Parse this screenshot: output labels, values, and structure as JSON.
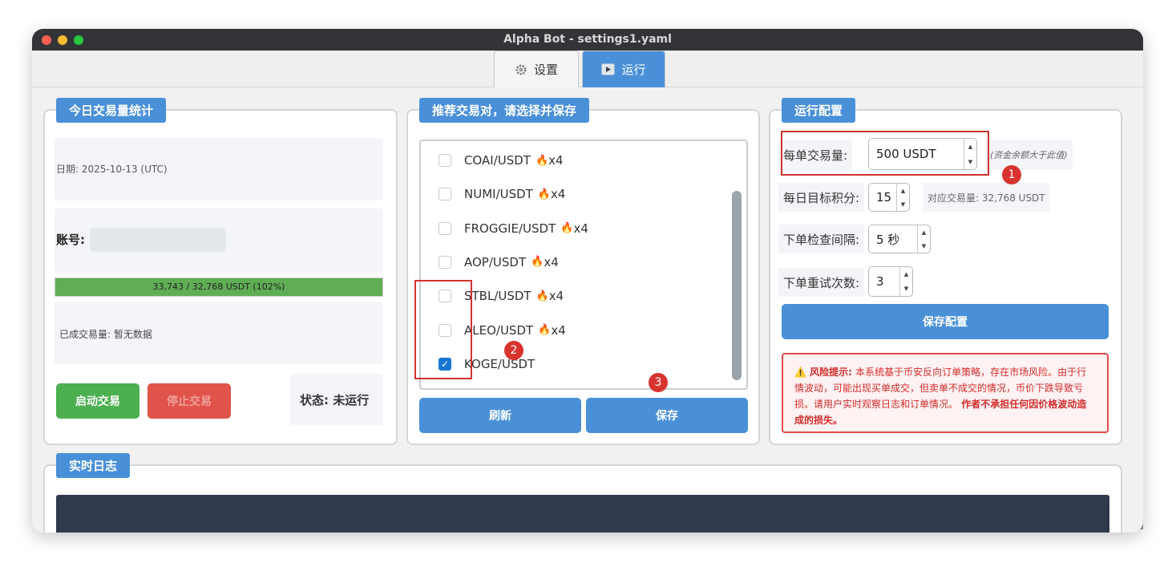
{
  "window": {
    "title": "Alpha Bot - settings1.yaml"
  },
  "colors": {
    "accent": "#4a90d9",
    "start": "#4caf50",
    "stop": "#e0534a",
    "warning": "#d42b2b",
    "progress": "#5fae54"
  },
  "tabs": [
    {
      "label": "设置",
      "icon": "gear-icon"
    },
    {
      "label": "运行",
      "icon": "play-icon"
    }
  ],
  "stats": {
    "title": "今日交易量统计",
    "date": "日期: 2025-10-13 (UTC)",
    "account_label": "账号: ı",
    "progress_text": "33,743 / 32,768 USDT (102%)",
    "progress_value": 1.0,
    "traded_label": "已成交易量: 暂无数据",
    "start_button": "启动交易",
    "stop_button": "停止交易",
    "status": "状态: 未运行"
  },
  "pairs": {
    "title": "推荐交易对，请选择并保存",
    "items": [
      {
        "label": "COAI/USDT",
        "multiplier": "x4",
        "hot": true,
        "checked": false
      },
      {
        "label": "NUMI/USDT",
        "multiplier": "x4",
        "hot": true,
        "checked": false
      },
      {
        "label": "FROGGIE/USDT",
        "multiplier": "x4",
        "hot": true,
        "checked": false
      },
      {
        "label": "AOP/USDT",
        "multiplier": "x4",
        "hot": true,
        "checked": false
      },
      {
        "label": "STBL/USDT",
        "multiplier": "x4",
        "hot": true,
        "checked": false
      },
      {
        "label": "ALEO/USDT",
        "multiplier": "x4",
        "hot": true,
        "checked": false
      },
      {
        "label": "KOGE/USDT",
        "multiplier": "",
        "hot": false,
        "checked": true
      }
    ],
    "refresh_button": "刷新",
    "save_button": "保存"
  },
  "config": {
    "title": "运行配置",
    "amount_label": "每单交易量:",
    "amount_value": "500 USDT",
    "amount_hint": "(资金余额大于此值)",
    "target_label": "每日目标积分:",
    "target_value": "15",
    "target_hint": "对应交易量: 32,768 USDT",
    "interval_label": "下单检查间隔:",
    "interval_value": "5 秒",
    "retry_label": "下单重试次数:",
    "retry_value": "3",
    "save_button": "保存配置",
    "warning_title": "⚠️ 风险提示:",
    "warning_body": "本系统基于币安反向订单策略，存在市场风险。由于行情波动，可能出现买单成交，但卖单不成交的情况，币价下跌导致亏损。请用户实时观察日志和订单情况。",
    "warning_strong": "作者不承担任何因价格波动造成的损失。"
  },
  "log": {
    "title": "实时日志"
  },
  "annotations": [
    "1",
    "2",
    "3"
  ]
}
